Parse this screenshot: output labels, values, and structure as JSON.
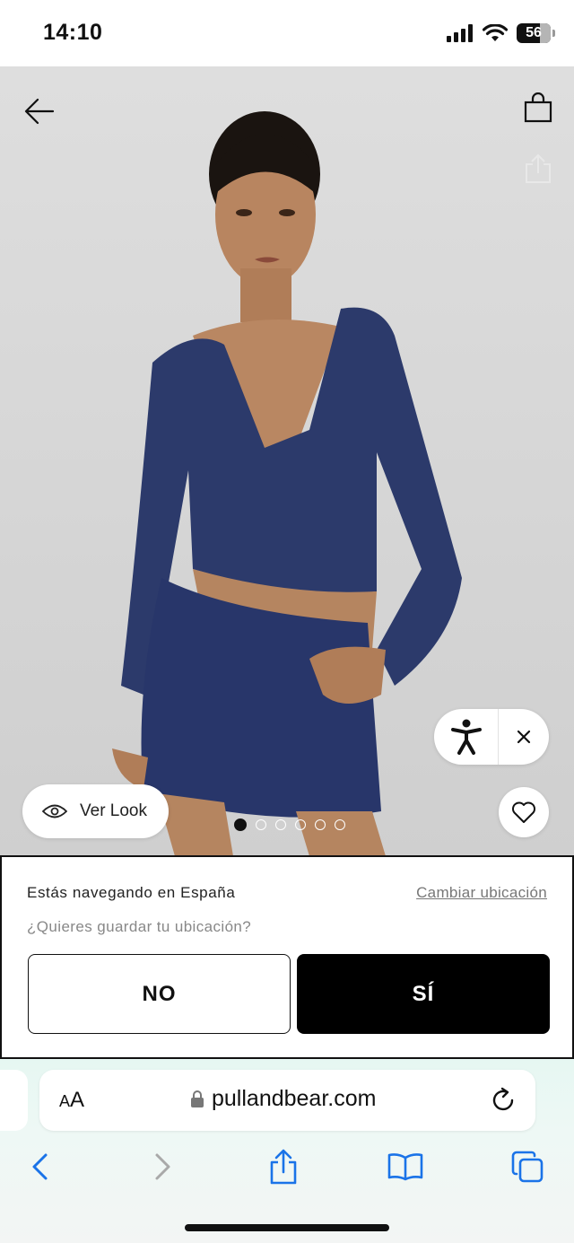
{
  "status_bar": {
    "time": "14:10",
    "battery": "56"
  },
  "product": {
    "ver_look_label": "Ver Look",
    "gallery": {
      "total_images": 6,
      "active_index": 0
    }
  },
  "location_banner": {
    "title": "Estás navegando en España",
    "change_link": "Cambiar ubicación",
    "question": "¿Quieres guardar tu ubicación?",
    "no_label": "NO",
    "yes_label": "SÍ"
  },
  "browser": {
    "aa_label_small": "A",
    "aa_label_large": "A",
    "url": "pullandbear.com"
  },
  "colors": {
    "accent_blue": "#1a73e8",
    "outfit_navy": "#2a3868",
    "background_gray": "#d8d8d8"
  },
  "icons": {
    "back": "arrow-left-icon",
    "bag": "shopping-bag-icon",
    "share": "share-icon",
    "eye": "eye-icon",
    "accessibility": "accessibility-icon",
    "close": "close-icon",
    "heart": "heart-icon",
    "lock": "lock-icon",
    "reload": "reload-icon"
  }
}
